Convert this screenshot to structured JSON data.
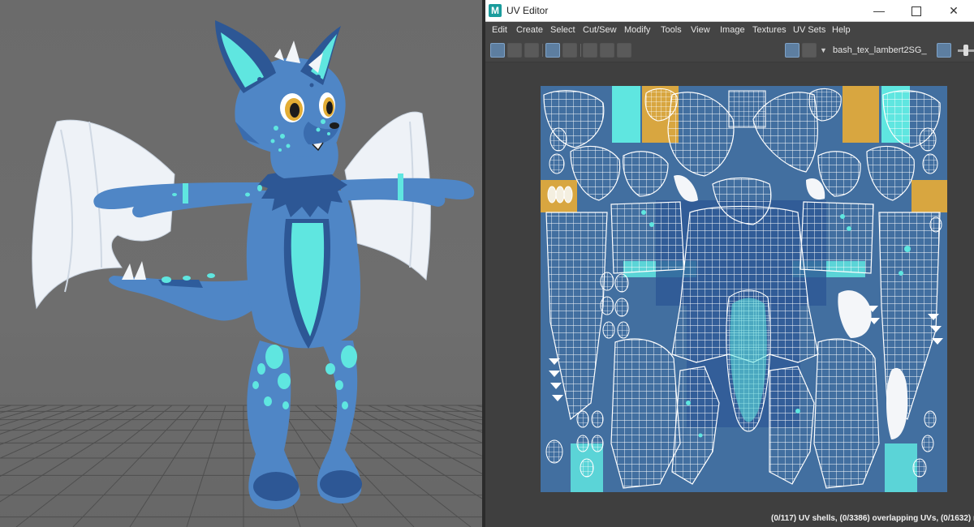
{
  "viewport": {
    "background_color": "#6c6c6c",
    "grid_color": "#4a4a4a",
    "character": "blue-dragon-fox-character"
  },
  "uv_editor": {
    "window_title": "UV Editor",
    "app_icon": "M",
    "window_controls": {
      "minimize": "—",
      "maximize": "□",
      "close": "✕"
    },
    "menu": [
      "Edit",
      "Create",
      "Select",
      "Cut/Sew",
      "Modify",
      "Tools",
      "View",
      "Image",
      "Textures",
      "UV Sets",
      "Help"
    ],
    "texture_name": "bash_tex_lambert2SG_",
    "status": "(0/117) UV shells, (0/3386) overlapping UVs, (0/1632) reve",
    "colors": {
      "texture_base": "#3e6a9c",
      "accent_cyan": "#5fe6e0",
      "accent_gold": "#d8a640",
      "wire": "#ffffff"
    }
  }
}
